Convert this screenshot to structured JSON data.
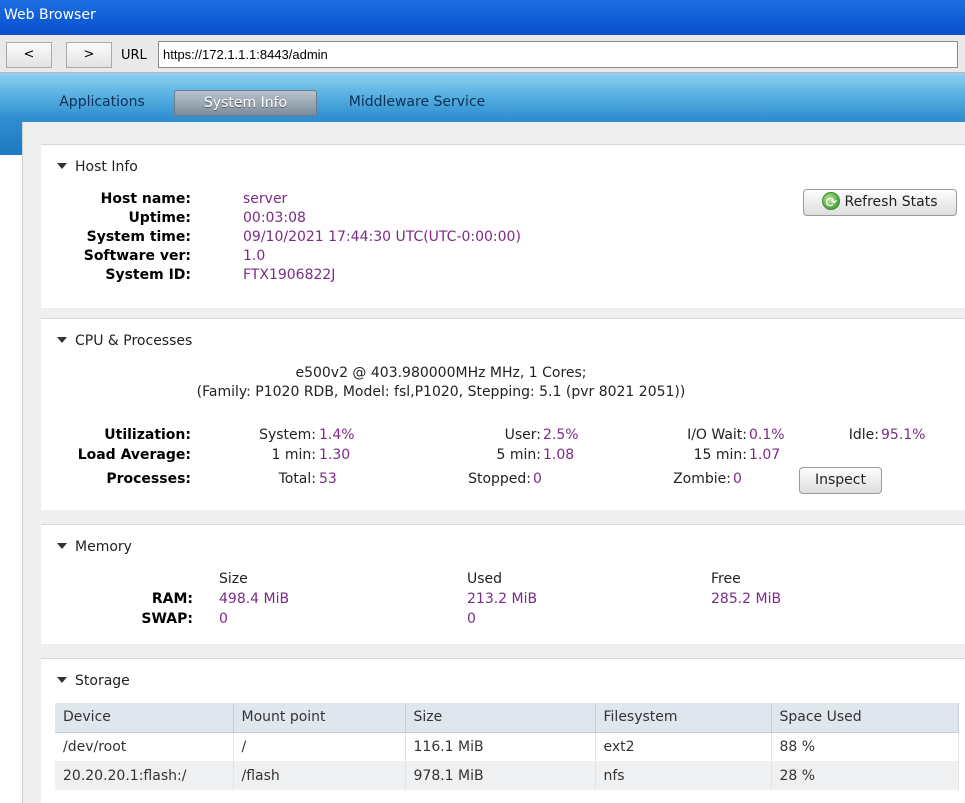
{
  "window": {
    "title": "Web Browser"
  },
  "browser": {
    "back_label": "<",
    "forward_label": ">",
    "url_label": "URL",
    "url": "https://172.1.1.1:8443/admin"
  },
  "tabs": [
    {
      "label": "Applications",
      "active": false
    },
    {
      "label": "System Info",
      "active": true
    },
    {
      "label": "Middleware Service",
      "active": false
    }
  ],
  "host_info": {
    "title": "Host Info",
    "rows": [
      {
        "label": "Host name:",
        "value": "server"
      },
      {
        "label": "Uptime:",
        "value": "00:03:08"
      },
      {
        "label": "System time:",
        "value": "09/10/2021 17:44:30 UTC(UTC-0:00:00)"
      },
      {
        "label": "Software ver:",
        "value": "1.0"
      },
      {
        "label": "System ID:",
        "value": "FTX1906822J"
      }
    ],
    "refresh_label": "Refresh Stats"
  },
  "cpu": {
    "title": "CPU & Processes",
    "cpu_line1": "e500v2 @ 403.980000MHz MHz, 1 Cores;",
    "cpu_line2": "(Family: P1020 RDB, Model: fsl,P1020, Stepping: 5.1 (pvr 8021 2051))",
    "utilization": {
      "label": "Utilization:",
      "system_label": "System:",
      "system": "1.4%",
      "user_label": "User:",
      "user": "2.5%",
      "iowait_label": "I/O Wait:",
      "iowait": "0.1%",
      "idle_label": "Idle:",
      "idle": "95.1%"
    },
    "load": {
      "label": "Load Average:",
      "m1_label": "1 min:",
      "m1": "1.30",
      "m5_label": "5 min:",
      "m5": "1.08",
      "m15_label": "15 min:",
      "m15": "1.07"
    },
    "processes": {
      "label": "Processes:",
      "total_label": "Total:",
      "total": "53",
      "stopped_label": "Stopped:",
      "stopped": "0",
      "zombie_label": "Zombie:",
      "zombie": "0"
    },
    "inspect_label": "Inspect"
  },
  "memory": {
    "title": "Memory",
    "col_size": "Size",
    "col_used": "Used",
    "col_free": "Free",
    "ram": {
      "label": "RAM:",
      "size": "498.4 MiB",
      "used": "213.2 MiB",
      "free": "285.2 MiB"
    },
    "swap": {
      "label": "SWAP:",
      "size": "0",
      "used": "0"
    }
  },
  "storage": {
    "title": "Storage",
    "columns": [
      "Device",
      "Mount point",
      "Size",
      "Filesystem",
      "Space Used"
    ],
    "rows": [
      [
        "/dev/root",
        "/",
        "116.1 MiB",
        "ext2",
        "88 %"
      ],
      [
        "20.20.20.1:flash:/",
        "/flash",
        "978.1 MiB",
        "nfs",
        "28 %"
      ]
    ]
  }
}
